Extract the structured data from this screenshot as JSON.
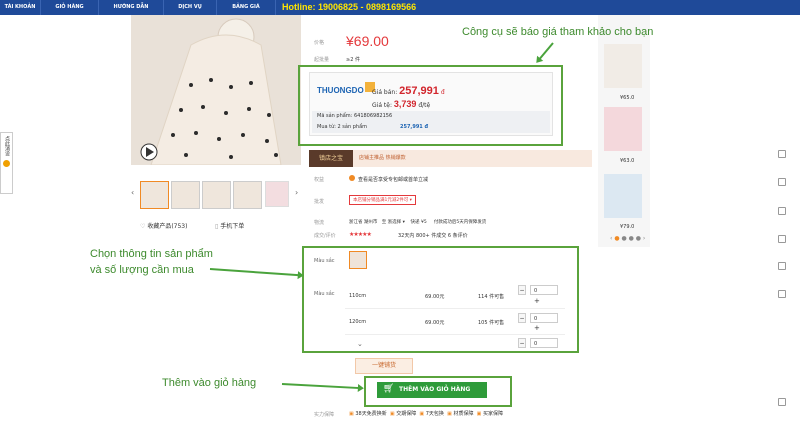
{
  "nav": {
    "items": [
      "TÀI KHOẢN",
      "GIỎ HÀNG",
      "HƯỚNG DẪN",
      "DỊCH VỤ",
      "BẢNG GIÁ"
    ],
    "hotline": "Hotline: 19006825 - 0898169566"
  },
  "product": {
    "price_label": "价格",
    "price": "¥69.00",
    "moq_label": "起批量",
    "moq": "≥2 件",
    "favorites": "收藏产品(753)",
    "phone_order": "手机下单",
    "shop_name": "镇店之宝",
    "shop_desc": "店铺主推品  热销爆款",
    "rights_label": "权益",
    "rights_text": "查看是否享受专包邮或首单立减",
    "discount_label": "批发",
    "discount_text": "本店铺分销品满1元减2件可 ▾",
    "shipping_label": "物流",
    "shipping_text": "浙江省 湖州市   至 浙选择 ▾    快递 ¥5     付款成功后5天内保障发货",
    "deal_label": "成交/评价",
    "deal_text": "32天内 800+ 件成交   6 条评价",
    "color_label": "Màu sắc",
    "size_label": "Màu sắc",
    "variants": [
      {
        "size": "110cm",
        "price": "69.00元",
        "stock": "114 件可售",
        "qty": "0"
      },
      {
        "size": "120cm",
        "price": "69.00元",
        "stock": "105 件可售",
        "qty": "0"
      },
      {
        "size": "",
        "price": "",
        "stock": "",
        "qty": "0"
      }
    ],
    "more": "⌄",
    "one_click": "一键铺货",
    "add_to_cart": "THÊM VÀO GIỎ HÀNG",
    "guarantee_label": "实力保障",
    "guarantees": [
      "38天免费换新",
      "交期保障",
      "7天包换",
      "材质保障",
      "买家保障"
    ]
  },
  "quote": {
    "brand": "THUONGDO",
    "sell_price_label": "Giá bán:",
    "sell_price": "257,991",
    "sell_currency": "đ",
    "rate_label": "Giá tệ:",
    "rate": "3,739",
    "rate_unit": "đ/tệ",
    "code_label": "Mã sản phẩm:",
    "code": "641806982156",
    "buy_label": "Mua từ: 2 sản phẩm",
    "buy_total": "257,991 đ"
  },
  "related": {
    "prices": [
      "¥65.0",
      "¥63.0",
      "¥79.0"
    ]
  },
  "left_tab": {
    "text": "点此消设"
  },
  "annotations": {
    "quote_note": "Công cụ sẽ báo giá tham khảo cho bạn",
    "select_note_1": "Chọn thông tin sản phẩm",
    "select_note_2": "và số lượng cần mua",
    "cart_note": "Thêm vào giỏ hàng"
  },
  "colors": {
    "nav": "#1f4a99",
    "hotline": "#ffe600",
    "price": "#e4393c",
    "annotation": "#3d8a2d",
    "cart_button": "#2e9b3a"
  }
}
